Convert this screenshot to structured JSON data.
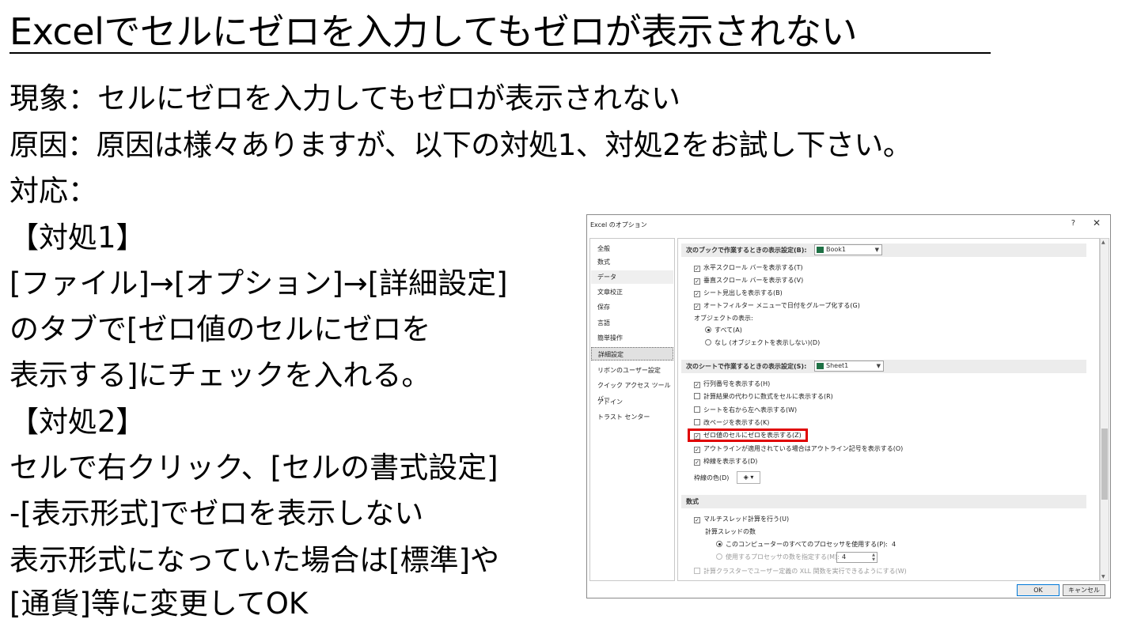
{
  "slide": {
    "title": "Excelでセルにゼロを入力してもゼロが表示されない",
    "lines": [
      "現象：セルにゼロを入力してもゼロが表示されない",
      "原因：原因は様々ありますが、以下の対処1、対処2をお試し下さい。",
      "対応：",
      "【対処1】",
      "[ファイル]→[オプション]→[詳細設定]",
      "のタブで[ゼロ値のセルにゼロを",
      "表示する]にチェックを入れる。",
      "【対処2】",
      "セルで右クリック、[セルの書式設定]",
      "-[表示形式]でゼロを表示しない",
      "表示形式になっていた場合は[標準]や",
      "[通貨]等に変更してOK"
    ]
  },
  "dialog": {
    "title": "Excel のオプション",
    "help": "?",
    "close": "✕",
    "nav": [
      "全般",
      "数式",
      "データ",
      "文章校正",
      "保存",
      "言語",
      "簡単操作",
      "詳細設定",
      "リボンのユーザー設定",
      "クイック アクセス ツール バー",
      "アドイン",
      "トラスト センター"
    ],
    "selected_nav": "詳細設定",
    "book_section": {
      "label": "次のブックで作業するときの表示設定(B):",
      "combo": "Book1",
      "options": [
        {
          "label": "水平スクロール バーを表示する(T)",
          "checked": true
        },
        {
          "label": "垂直スクロール バーを表示する(V)",
          "checked": true
        },
        {
          "label": "シート見出しを表示する(B)",
          "checked": true
        },
        {
          "label": "オートフィルター メニューで日付をグループ化する(G)",
          "checked": true
        }
      ],
      "objects_label": "オブジェクトの表示:",
      "radio_all": "すべて(A)",
      "radio_none": "なし (オブジェクトを表示しない)(D)"
    },
    "sheet_section": {
      "label": "次のシートで作業するときの表示設定(S):",
      "combo": "Sheet1",
      "options": [
        {
          "label": "行列番号を表示する(H)",
          "checked": true
        },
        {
          "label": "計算結果の代わりに数式をセルに表示する(R)",
          "checked": false
        },
        {
          "label": "シートを右から左へ表示する(W)",
          "checked": false
        },
        {
          "label": "改ページを表示する(K)",
          "checked": false
        },
        {
          "label": "ゼロ値のセルにゼロを表示する(Z)",
          "checked": true
        },
        {
          "label": "アウトラインが適用されている場合はアウトライン記号を表示する(O)",
          "checked": true
        },
        {
          "label": "枠線を表示する(D)",
          "checked": true
        }
      ],
      "gridline_color_label": "枠線の色(D)"
    },
    "formula_section": {
      "label": "数式",
      "multithread": "マルチスレッド計算を行う(U)",
      "threads_label": "計算スレッドの数",
      "radio_all_procs": "このコンピューターのすべてのプロセッサを使用する(P):",
      "all_procs_value": "4",
      "radio_manual": "使用するプロセッサの数を指定する(M):",
      "manual_value": "4",
      "cluster": "計算クラスターでユーザー定義の XLL 関数を実行できるようにする(W)"
    },
    "ok": "OK",
    "cancel": "キャンセル"
  },
  "colors": {
    "highlight": "#e00000",
    "excel_green": "#1e7145"
  }
}
